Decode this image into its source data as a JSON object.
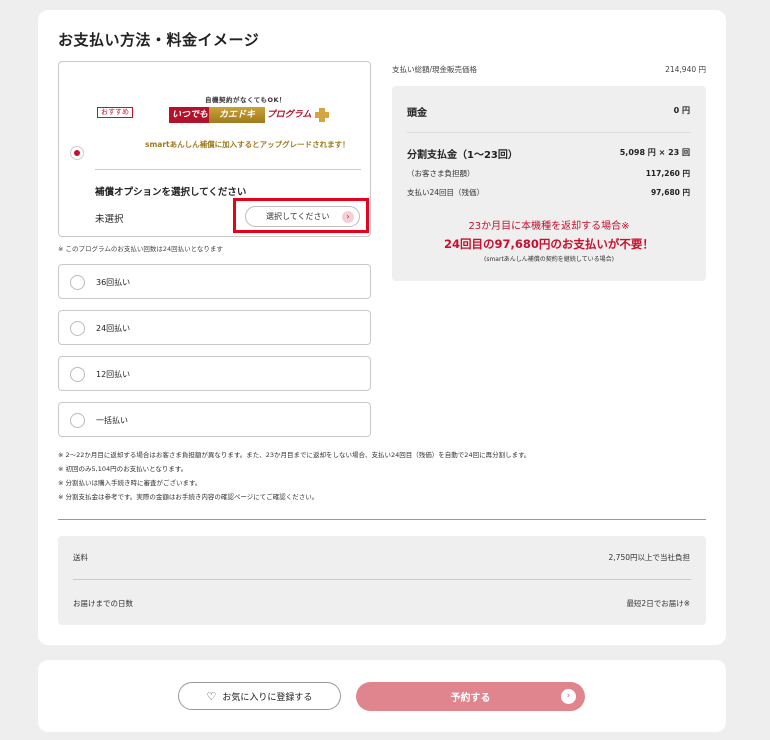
{
  "section_title": "お支払い方法・料金イメージ",
  "plan": {
    "tag": "おすすめ",
    "banner_sub": "自機契約がなくてもOK！",
    "logo_seg1": "いつでも",
    "logo_seg2": "カエドキ",
    "logo_seg3": "プログラム",
    "banner_desc": "smartあんしん補償に加入するとアップグレードされます！",
    "option_heading": "補償オプションを選択してください",
    "option_value": "未選択",
    "select_button": "選択してください",
    "note": "※ このプログラムのお支払い回数は24回払いとなります"
  },
  "payment_options": [
    {
      "label": "36回払い"
    },
    {
      "label": "24回払い"
    },
    {
      "label": "12回払い"
    },
    {
      "label": "一括払い"
    }
  ],
  "price": {
    "total_label": "支払い総額/現金販売価格",
    "total_value": "214,940 円",
    "downpayment_label": "頭金",
    "downpayment_value": "0 円",
    "installment_label": "分割支払金（1〜23回）",
    "installment_value": "5,098 円 × 23 回",
    "customer_label": "（お客さま負担額）",
    "customer_value": "117,260 円",
    "final_label": "支払い24回目（残価）",
    "final_value": "97,680 円",
    "alert_line1": "23か月目に本機種を返却する場合※",
    "alert_line2": "24回目の97,680円のお支払いが不要！",
    "alert_line3": "(smartあんしん補償の契約を継続している場合)"
  },
  "notes": [
    "※ 2〜22か月目に返却する場合はお客さま負担額が異なります。また、23か月目までに返却をしない場合、支払い24回目（残価）を自動で24回に再分割します。",
    "※ 初回のみ5,104円のお支払いとなります。",
    "※ 分割払いは購入手続き時に審査がございます。",
    "※ 分割支払金は参考です。実際の金額はお手続き内容の確認ページにてご確認ください。"
  ],
  "shipping": {
    "fee_label": "送料",
    "fee_value": "2,750円以上で当社負担",
    "days_label": "お届けまでの日数",
    "days_value": "最短2日でお届け※"
  },
  "actions": {
    "favorite_label": "お気に入りに登録する",
    "reserve_label": "予約する"
  },
  "colors": {
    "accent": "#c8102e",
    "reserve_button": "#e0848d",
    "highlight": "#e8001c"
  }
}
